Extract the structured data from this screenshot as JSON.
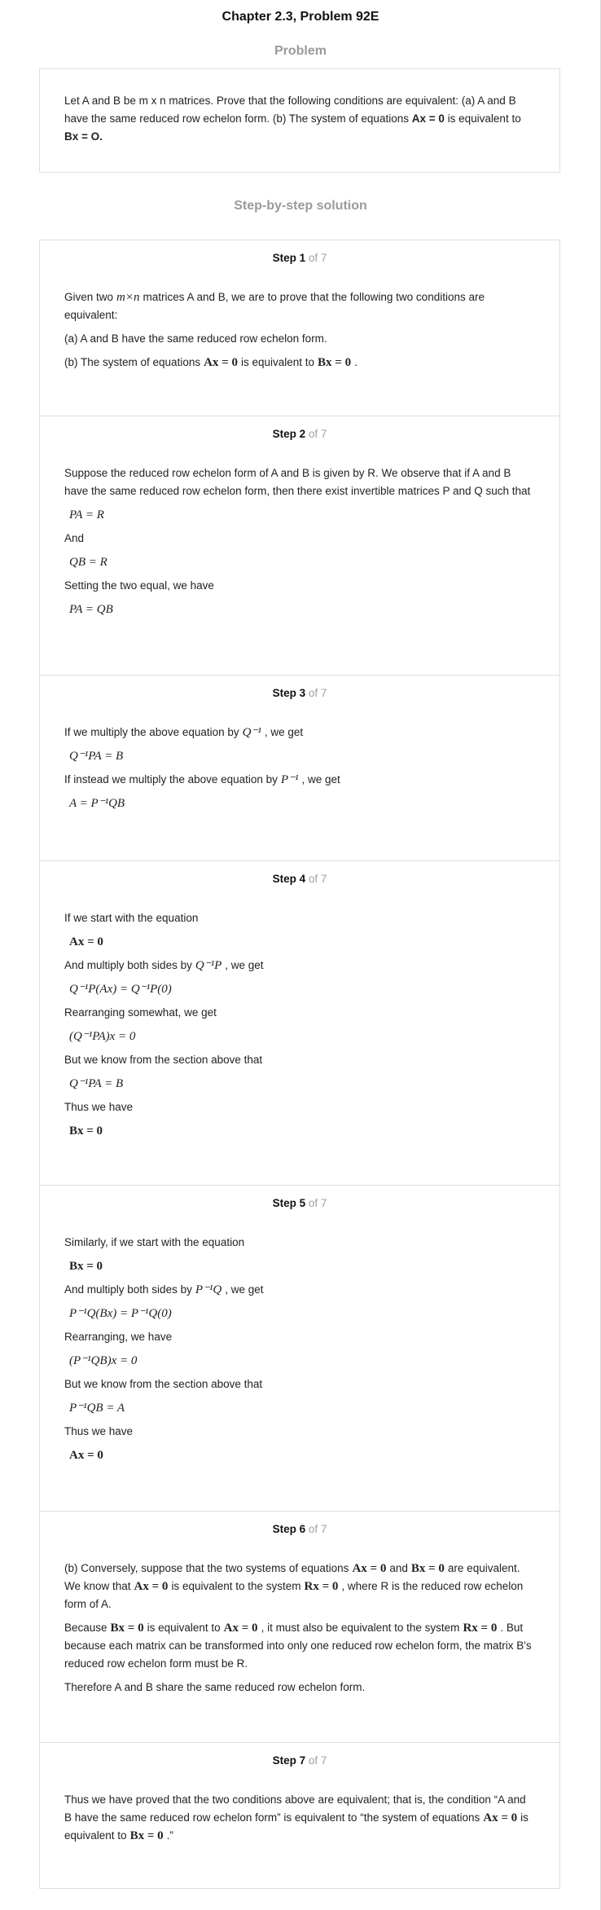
{
  "header": {
    "title": "Chapter 2.3, Problem 92E"
  },
  "problem": {
    "heading": "Problem",
    "text_a": "Let A and B be m x n matrices. Prove that the following conditions are equivalent: (a) A and B have the same reduced row echelon form. (b) The system of equations ",
    "eq1": "Ax = 0",
    "text_b": " is equivalent to ",
    "eq2": "Bx = O."
  },
  "solution_heading": "Step-by-step solution",
  "steps": [
    {
      "label": "Step 1",
      "of": "of 7",
      "l1a": "Given two",
      "l1m": "m×n",
      "l1b": "matrices A and B, we are to prove that the following two conditions are equivalent:",
      "l2": "(a) A and B have the same reduced row echelon form.",
      "l3a": "(b) The system of equations",
      "l3m1": "Ax = 0",
      "l3b": "is equivalent to",
      "l3m2": "Bx = 0",
      "l3c": "."
    },
    {
      "label": "Step 2",
      "of": "of 7",
      "l1": "Suppose the reduced row echelon form of A and B is given by R. We observe that if A and B have the same reduced row echelon form, then there exist invertible matrices P and Q such that",
      "m1": "PA = R",
      "l2": "And",
      "m2": "QB = R",
      "l3": "Setting the two equal, we have",
      "m3": "PA = QB"
    },
    {
      "label": "Step 3",
      "of": "of 7",
      "l1a": "If we multiply the above equation by",
      "l1m": "Q⁻¹",
      "l1b": ", we get",
      "m1": "Q⁻¹PA = B",
      "l2a": "If instead we multiply the above equation by",
      "l2m": "P⁻¹",
      "l2b": ", we get",
      "m2": "A = P⁻¹QB"
    },
    {
      "label": "Step 4",
      "of": "of 7",
      "l1": "If we start with the equation",
      "m1": "Ax = 0",
      "l2a": "And multiply both sides by",
      "l2m": "Q⁻¹P",
      "l2b": ", we get",
      "m2": "Q⁻¹P(Ax) = Q⁻¹P(0)",
      "l3": "Rearranging somewhat, we get",
      "m3": "(Q⁻¹PA)x = 0",
      "l4": "But we know from the section above that",
      "m4": "Q⁻¹PA = B",
      "l5": "Thus we have",
      "m5": "Bx = 0"
    },
    {
      "label": "Step 5",
      "of": "of 7",
      "l1": "Similarly, if we start with the equation",
      "m1": "Bx = 0",
      "l2a": "And multiply both sides by",
      "l2m": "P⁻¹Q",
      "l2b": ", we get",
      "m2": "P⁻¹Q(Bx) = P⁻¹Q(0)",
      "l3": "Rearranging, we have",
      "m3": "(P⁻¹QB)x = 0",
      "l4": "But we know from the section above that",
      "m4": "P⁻¹QB = A",
      "l5": "Thus we have",
      "m5": "Ax = 0"
    },
    {
      "label": "Step 6",
      "of": "of 7",
      "p1a": "(b) Conversely, suppose that the two systems of equations",
      "p1m1": "Ax = 0",
      "p1b": "and",
      "p1m2": "Bx = 0",
      "p1c": "are equivalent. We know that",
      "p1m3": "Ax = 0",
      "p1d": "is equivalent to the system",
      "p1m4": "Rx = 0",
      "p1e": ", where R is the reduced row echelon form of A.",
      "p2a": "Because",
      "p2m1": "Bx = 0",
      "p2b": "is equivalent to",
      "p2m2": "Ax = 0",
      "p2c": ", it must also be equivalent to the system",
      "p2m3": "Rx = 0",
      "p2d": ". But because each matrix can be transformed into only one reduced row echelon form, the matrix B's reduced row echelon form must be R.",
      "p3": "Therefore A and B share the same reduced row echelon form."
    },
    {
      "label": "Step 7",
      "of": "of 7",
      "p1a": "Thus we have proved that the two conditions above are equivalent; that is, the condition “A and B have the same reduced row echelon form” is equivalent to “the system of equations",
      "p1m1": "Ax = 0",
      "p1b": "is equivalent to",
      "p1m2": "Bx = 0",
      "p1c": ".”"
    }
  ]
}
